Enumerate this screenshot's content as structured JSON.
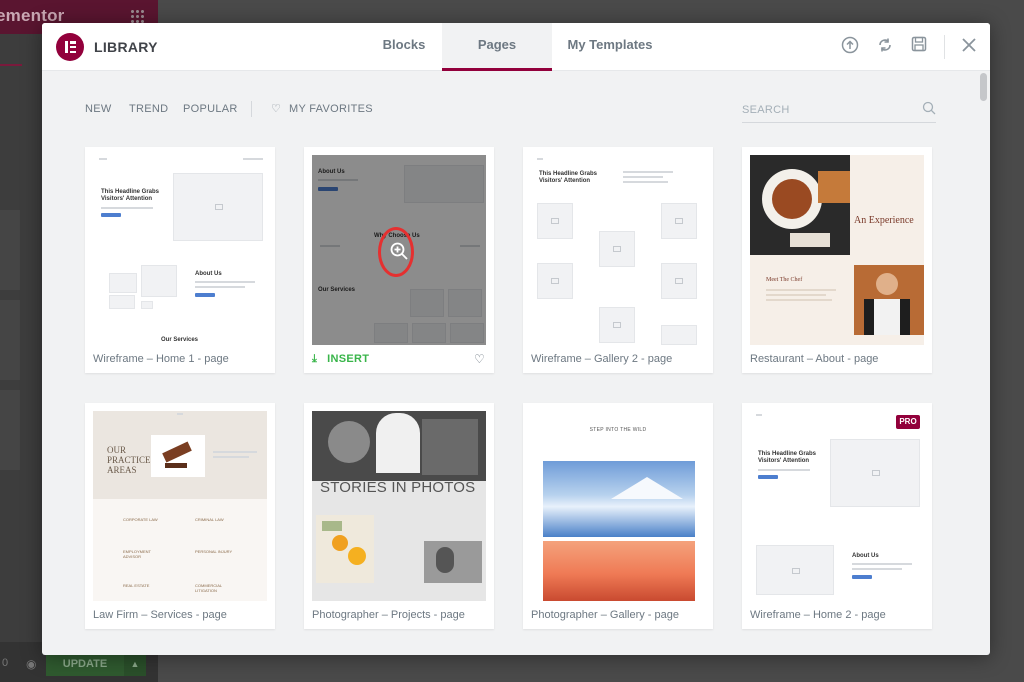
{
  "background": {
    "brand": "ementor",
    "update_label": "UPDATE"
  },
  "modal": {
    "title": "LIBRARY",
    "tabs": [
      {
        "label": "Blocks"
      },
      {
        "label": "Pages"
      },
      {
        "label": "My Templates"
      }
    ],
    "header_icons": [
      "upload-icon",
      "sync-icon",
      "save-icon",
      "close-icon"
    ]
  },
  "filters": {
    "items": [
      "NEW",
      "TREND",
      "POPULAR"
    ],
    "favorites": "MY FAVORITES",
    "search_placeholder": "SEARCH"
  },
  "cards": [
    {
      "label": "Wireframe – Home 1 - page"
    },
    {
      "label": "",
      "insert_label": "INSERT"
    },
    {
      "label": "Wireframe – Gallery 2 - page"
    },
    {
      "label": "Restaurant – About - page"
    },
    {
      "label": "Law Firm – Services - page"
    },
    {
      "label": "Photographer – Projects - page"
    },
    {
      "label": "Photographer – Gallery - page"
    },
    {
      "label": "Wireframe – Home 2 - page",
      "badge": "PRO"
    }
  ],
  "thumb_text": {
    "headline": "This Headline Grabs Visitors' Attention",
    "about": "About Us",
    "services": "Our Services",
    "why": "Why Choose Us",
    "experience": "An Experience",
    "chef": "Meet The Chef",
    "practice": "OUR PRACTICE AREAS",
    "stories": "STORIES IN PHOTOS",
    "wild": "STEP INTO THE WILD",
    "law_items": [
      "CORPORATE LAW",
      "CRIMINAL LAW",
      "EMPLOYMENT ADVISOR",
      "PERSONAL INJURY",
      "REAL ESTATE",
      "COMMERCIAL LITIGATION"
    ]
  },
  "colors": {
    "brand": "#92003b",
    "insert": "#39b54a",
    "highlight_ring": "#e53030"
  }
}
